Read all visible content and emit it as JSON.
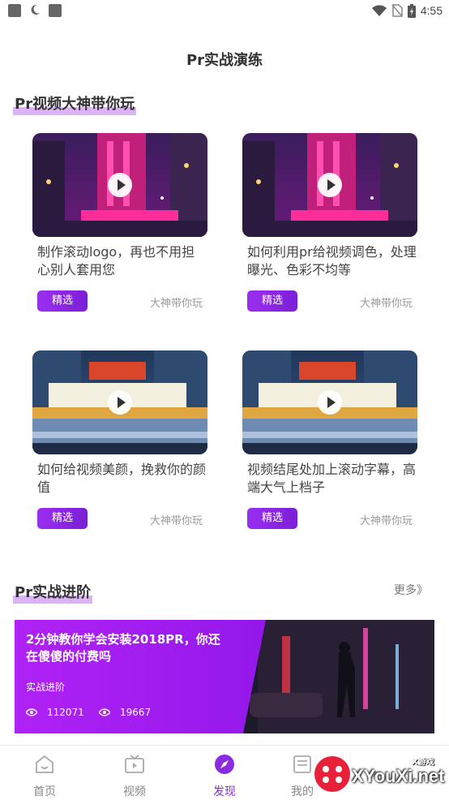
{
  "status_bar": {
    "time": "4:55",
    "icons": [
      "app-square-icon",
      "moon-icon",
      "app-square-icon",
      "wifi-icon",
      "no-sim-icon",
      "battery-icon"
    ]
  },
  "page_title": "Pr实战演练",
  "section1": {
    "title": "Pr视频大神带你玩"
  },
  "cards": [
    {
      "title": "制作滚动logo，再也不用担心别人套用您",
      "tag": "精选",
      "author": "大神带你玩",
      "thumb": "radio-city-night"
    },
    {
      "title": "如何利用pr给视频调色，处理曝光、色彩不均等",
      "tag": "精选",
      "author": "大神带你玩",
      "thumb": "radio-city-night"
    },
    {
      "title": "如何给视频美颜，挽救你的颜值",
      "tag": "精选",
      "author": "大神带你玩",
      "thumb": "chicago-theatre-night"
    },
    {
      "title": "视频结尾处加上滚动字幕，高端大气上档子",
      "tag": "精选",
      "author": "大神带你玩",
      "thumb": "chicago-theatre-night"
    }
  ],
  "section2": {
    "title": "Pr实战进阶",
    "more": "更多》"
  },
  "banner": {
    "title": "2分钟教你学会安装2018PR，你还在傻傻的付费吗",
    "category": "实战进阶",
    "views": "112071",
    "plays": "19667"
  },
  "nav": {
    "items": [
      {
        "label": "首页",
        "icon": "home-icon"
      },
      {
        "label": "视频",
        "icon": "tv-icon"
      },
      {
        "label": "发现",
        "icon": "compass-icon",
        "active": true
      },
      {
        "label": "我的",
        "icon": "profile-icon"
      }
    ]
  },
  "watermark": {
    "text": "XYouXi.net",
    "sub": "X游戏"
  },
  "colors": {
    "accent": "#8a2be2",
    "highlight": "#dcb3f4",
    "banner": "#a020f0"
  }
}
